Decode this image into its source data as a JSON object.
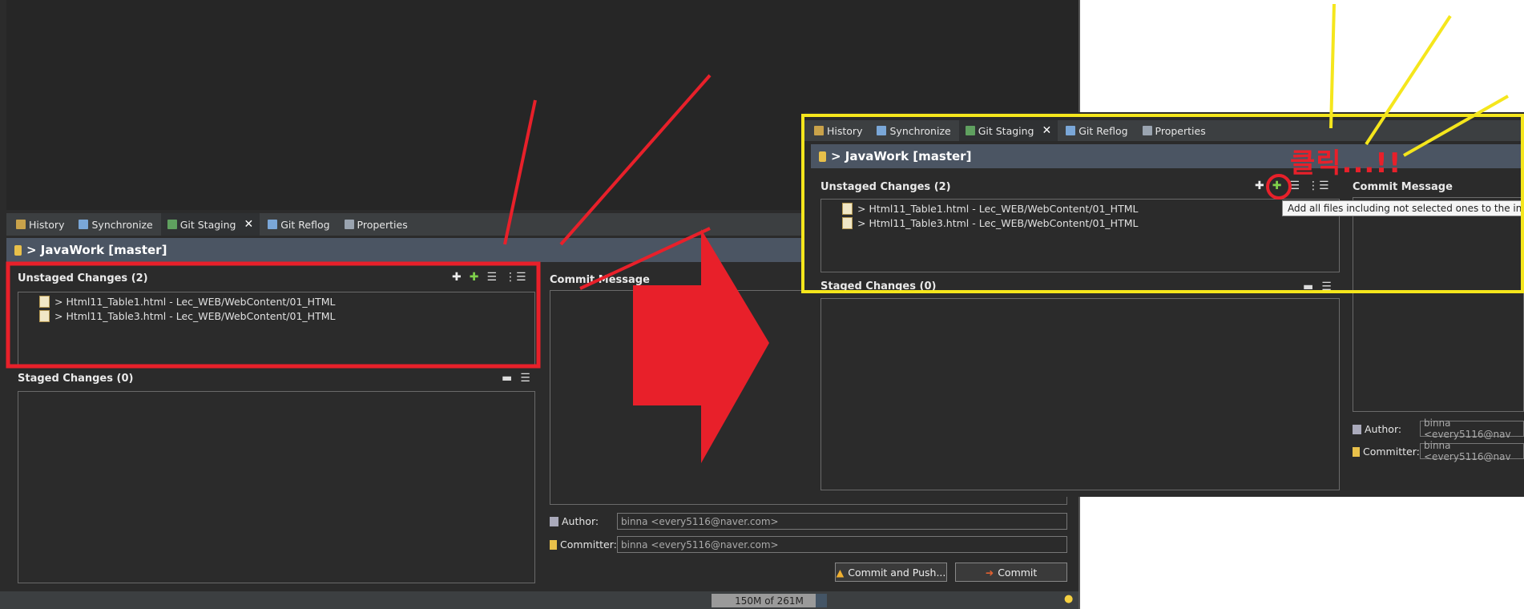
{
  "tabs": [
    {
      "label": "History",
      "color": "#c9a24a"
    },
    {
      "label": "Synchronize",
      "color": "#7aa7d8"
    },
    {
      "label": "Git Staging",
      "color": "#5fa05f"
    },
    {
      "label": "Git Reflog",
      "color": "#7aa7d8"
    },
    {
      "label": "Properties",
      "color": "#9aa4b0"
    }
  ],
  "repo": {
    "title": "> JavaWork [master]"
  },
  "unstaged": {
    "title": "Unstaged Changes (2)",
    "files": [
      {
        "name": "> Html11_Table1.html - Lec_WEB/WebContent/01_HTML"
      },
      {
        "name": "> Html11_Table3.html - Lec_WEB/WebContent/01_HTML"
      }
    ]
  },
  "staged": {
    "title": "Staged Changes (0)"
  },
  "commit": {
    "title": "Commit Message",
    "author_label": "Author:",
    "author_value": "binna <every5116@naver.com>",
    "author_value_zoom": "binna <every5116@nav",
    "committer_label": "Committer:",
    "committer_value": "binna <every5116@naver.com>",
    "committer_value_zoom": "binna <every5116@nav",
    "commit_push_label": "Commit and Push...",
    "commit_label": "Commit"
  },
  "status": {
    "memory": "150M of 261M"
  },
  "tooltip": "Add all files including not selected ones to the index",
  "annotation": {
    "korean": "클릭...!!"
  },
  "colors": {
    "red": "#e8202a",
    "yellow": "#f5e61c"
  }
}
